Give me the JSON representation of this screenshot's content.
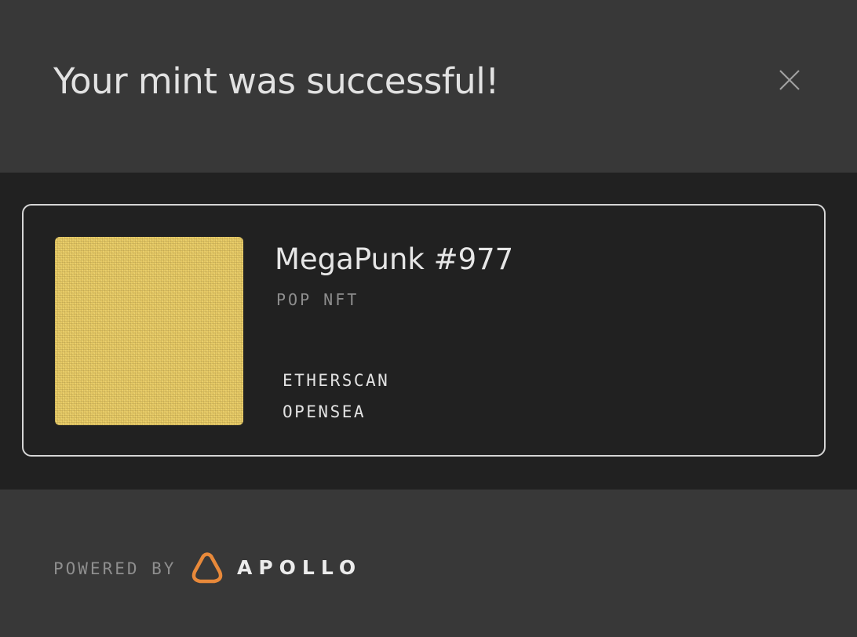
{
  "header": {
    "title": "Your mint was successful!",
    "close_icon": "close-icon"
  },
  "nft": {
    "name": "MegaPunk #977",
    "collection": "POP NFT",
    "image_color": "#e6c965",
    "links": {
      "etherscan": "ETHERSCAN",
      "opensea": "OPENSEA"
    }
  },
  "footer": {
    "powered_by": "POWERED BY",
    "brand": "APOLLO",
    "brand_icon": "apollo-logo-icon",
    "brand_color": "#e8893a"
  },
  "colors": {
    "background": "#383838",
    "panel": "#212121",
    "card_border": "#d6d6d6",
    "muted_text": "#8e8e8e"
  }
}
